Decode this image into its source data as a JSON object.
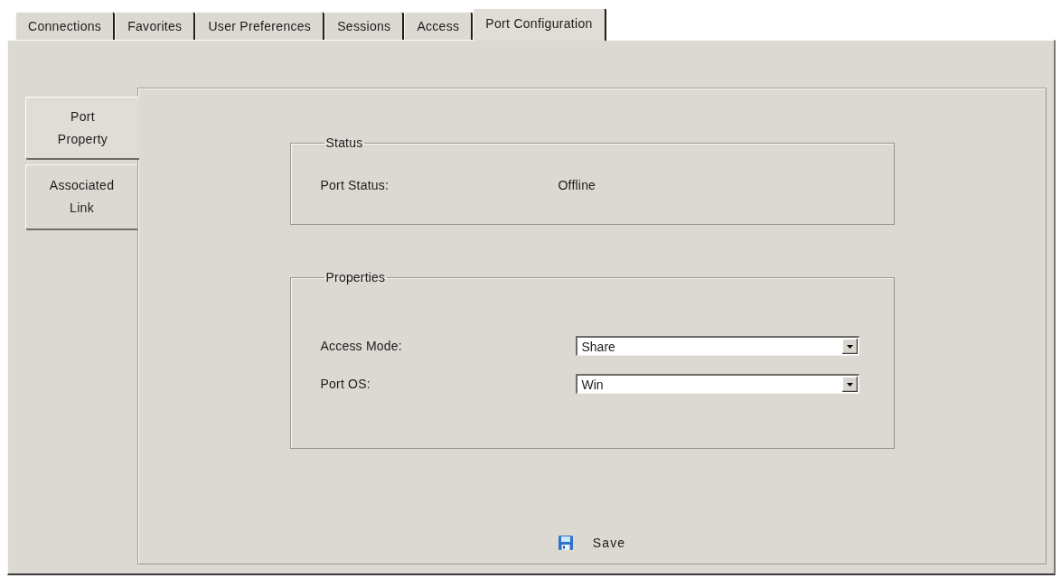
{
  "tabs": [
    {
      "label": "Connections",
      "selected": false
    },
    {
      "label": "Favorites",
      "selected": false
    },
    {
      "label": "User Preferences",
      "selected": false
    },
    {
      "label": "Sessions",
      "selected": false
    },
    {
      "label": "Access",
      "selected": false
    },
    {
      "label": "Port Configuration",
      "selected": true
    }
  ],
  "side_tabs": [
    {
      "label": "Port Property",
      "selected": true
    },
    {
      "label": "Associated Link",
      "selected": false
    }
  ],
  "status_group": {
    "title": "Status",
    "fields": [
      {
        "label": "Port Status:",
        "value": "Offline"
      }
    ]
  },
  "properties_group": {
    "title": "Properties",
    "fields": [
      {
        "label": "Access Mode:",
        "value": "Share"
      },
      {
        "label": "Port OS:",
        "value": "Win"
      }
    ]
  },
  "save_button": {
    "label": "Save"
  }
}
